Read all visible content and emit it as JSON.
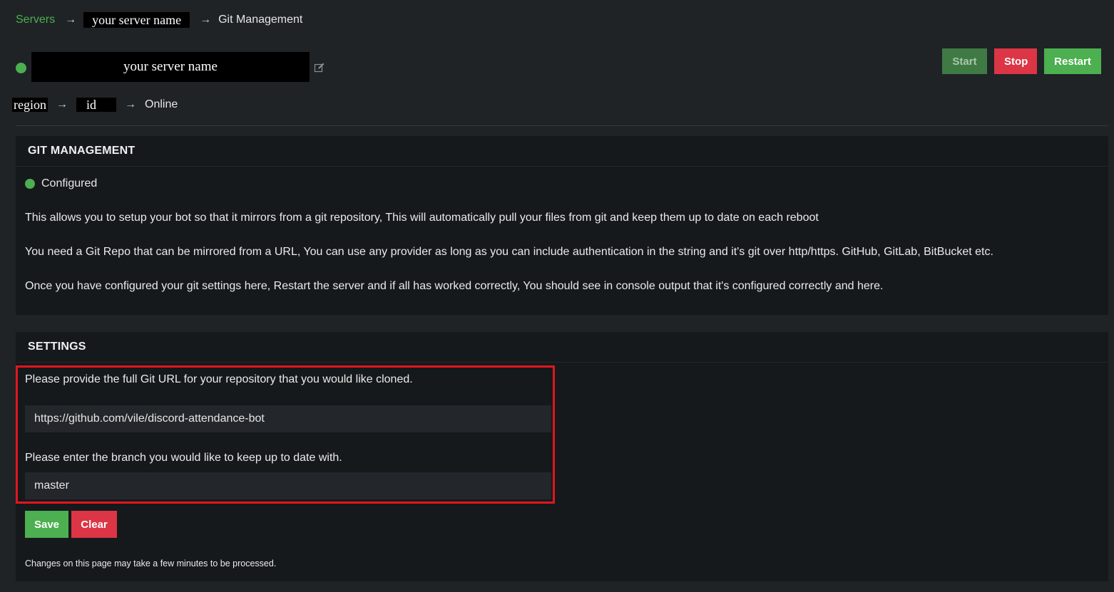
{
  "breadcrumb": {
    "root": "Servers",
    "arrow": "→",
    "server": "your server name",
    "current": "Git Management"
  },
  "server": {
    "name": "your server name",
    "status_color": "#4caf50"
  },
  "controls": {
    "start": "Start",
    "stop": "Stop",
    "restart": "Restart"
  },
  "location": {
    "region": "region",
    "id": "id",
    "status": "Online",
    "arrow": "→"
  },
  "git_panel": {
    "title": "GIT MANAGEMENT",
    "status": "Configured",
    "paragraphs": [
      "This allows you to setup your bot so that it mirrors from a git repository, This will automatically pull your files from git and keep them up to date on each reboot",
      "You need a Git Repo that can be mirrored from a URL, You can use any provider as long as you can include authentication in the string and it's git over http/https. GitHub, GitLab, BitBucket etc.",
      "Once you have configured your git settings here, Restart the server and if all has worked correctly, You should see in console output that it's configured correctly and here."
    ]
  },
  "settings_panel": {
    "title": "SETTINGS",
    "url_label": "Please provide the full Git URL for your repository that you would like cloned.",
    "url_value": "https://github.com/vile/discord-attendance-bot",
    "branch_label": "Please enter the branch you would like to keep up to date with.",
    "branch_value": "master",
    "save": "Save",
    "clear": "Clear",
    "note": "Changes on this page may take a few minutes to be processed."
  },
  "colors": {
    "accent_green": "#4caf50",
    "danger_red": "#dc3545",
    "highlight_red": "#e0161e",
    "background": "#1f2326",
    "panel": "#16191c"
  },
  "icons": {
    "status": "status-dot-icon",
    "edit": "edit-pencil-icon",
    "arrow": "arrow-right-icon"
  }
}
